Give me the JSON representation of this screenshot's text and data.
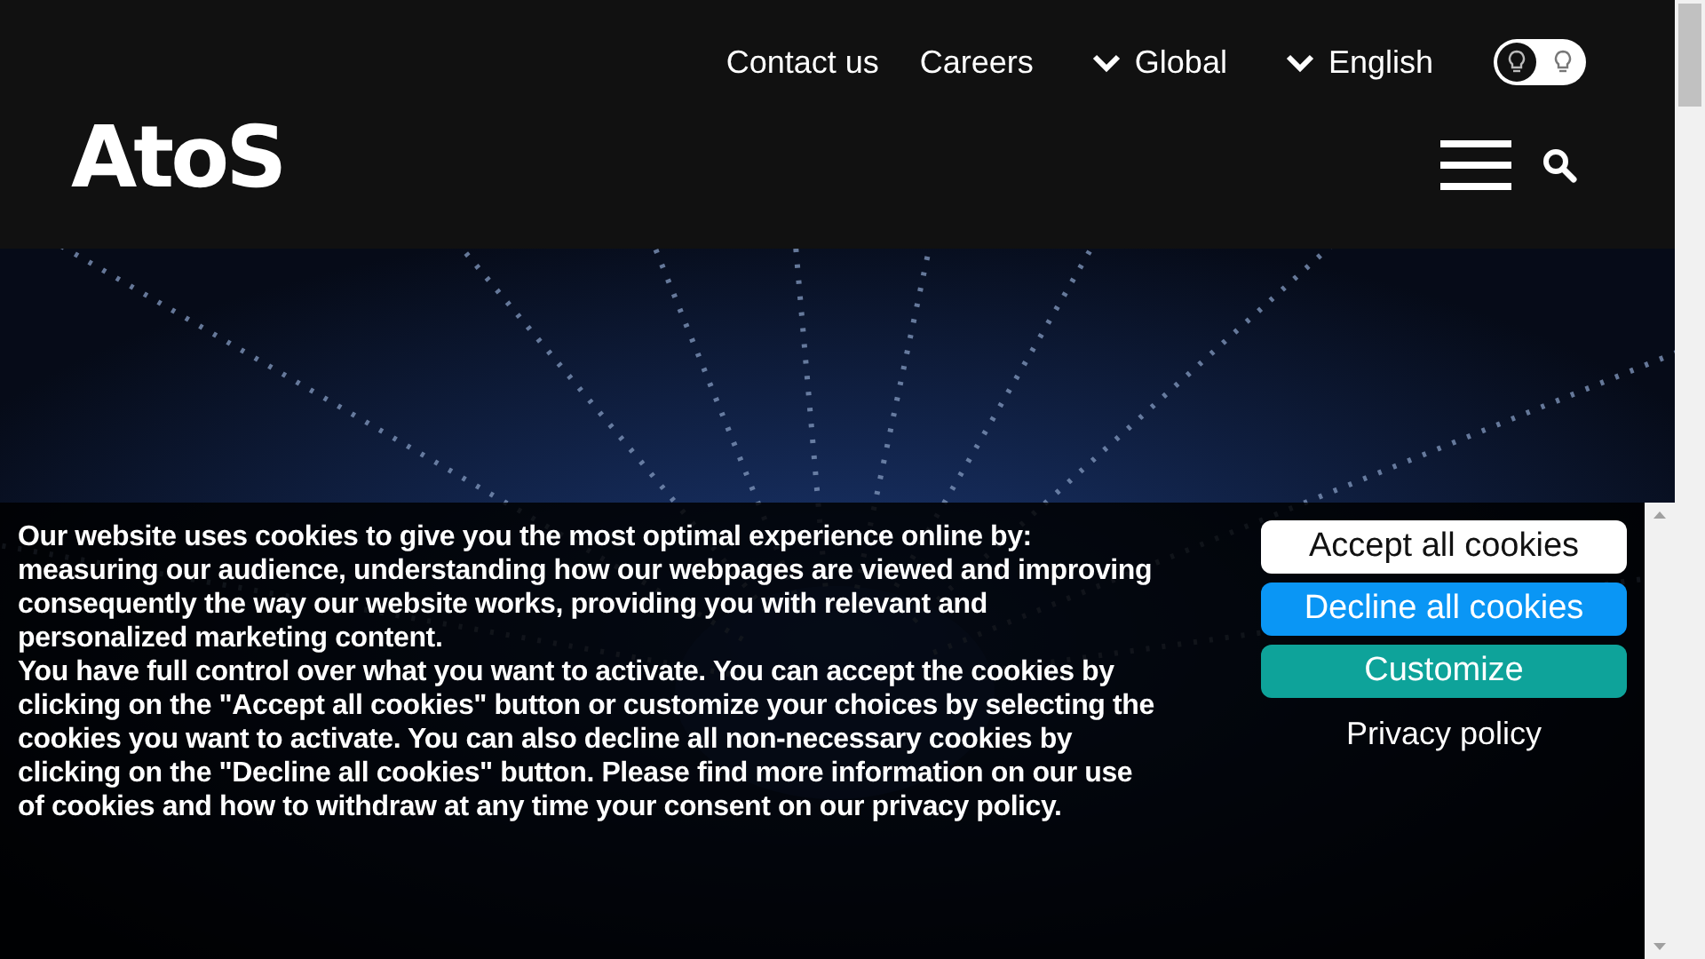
{
  "header": {
    "utility_links": [
      {
        "label": "Contact us",
        "kind": "link"
      },
      {
        "label": "Careers",
        "kind": "link"
      },
      {
        "label": "Global",
        "kind": "dropdown"
      },
      {
        "label": "English",
        "kind": "dropdown"
      }
    ],
    "theme_toggle": {
      "light_mode": false
    },
    "logo": "AtoS"
  },
  "cookie_banner": {
    "paragraphs": [
      "Our website uses cookies to give you the most optimal experience online by: measuring our audience, understanding how our webpages are viewed and improving consequently the way our website works, providing you with relevant and personalized marketing content.",
      "You have full control over what you want to activate. You can accept the cookies by clicking on the \"Accept all cookies\" button or customize your choices by selecting the cookies you want to activate. You can also decline all non-necessary cookies by clicking on the \"Decline all cookies\" button. Please find more information on our use of cookies and how to withdraw at any time your consent on our privacy policy."
    ],
    "buttons": [
      {
        "label": "Accept all cookies",
        "kind": "accept"
      },
      {
        "label": "Decline all cookies",
        "kind": "decline"
      },
      {
        "label": "Customize",
        "kind": "customize"
      },
      {
        "label": "Privacy policy",
        "kind": "link"
      }
    ]
  }
}
